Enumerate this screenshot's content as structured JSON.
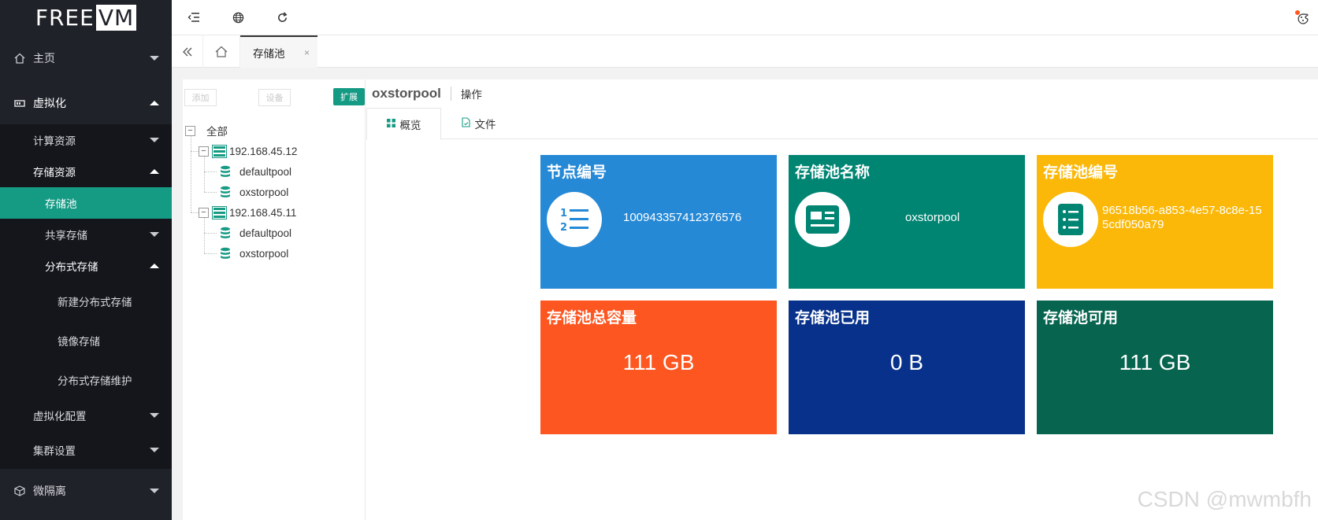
{
  "app": {
    "logo_left": "FREE",
    "logo_right": "VM"
  },
  "sidebar": {
    "home": "主页",
    "virtualization": "虚拟化",
    "compute": "计算资源",
    "storage": "存储资源",
    "storage_pool": "存储池",
    "shared_storage": "共享存储",
    "distributed_storage": "分布式存储",
    "new_distributed": "新建分布式存储",
    "image_storage": "镜像存储",
    "distributed_maint": "分布式存储维护",
    "virt_config": "虚拟化配置",
    "cluster_settings": "集群设置",
    "micro_isolation": "微隔离"
  },
  "tabbar": {
    "current_tab": "存储池",
    "close": "×"
  },
  "tree_panel": {
    "btn_add": "添加",
    "btn_device": "设备",
    "btn_extend": "扩展",
    "root": "全部",
    "hosts": [
      {
        "ip": "192.168.45.12",
        "pools": [
          "defaultpool",
          "oxstorpool"
        ]
      },
      {
        "ip": "192.168.45.11",
        "pools": [
          "defaultpool",
          "oxstorpool"
        ]
      }
    ]
  },
  "main": {
    "pool_title": "oxstorpool",
    "operation": "操作",
    "tab_overview": "概览",
    "tab_files": "文件"
  },
  "cards": {
    "node_id_title": "节点编号",
    "node_id_value": "100943357412376576",
    "pool_name_title": "存储池名称",
    "pool_name_value": "oxstorpool",
    "pool_id_title": "存储池编号",
    "pool_id_value": "96518b56-a853-4e57-8c8e-155cdf050a79",
    "total_title": "存储池总容量",
    "total_value": "111 GB",
    "used_title": "存储池已用",
    "used_value": "0 B",
    "avail_title": "存储池可用",
    "avail_value": "111 GB"
  },
  "colors": {
    "accent": "#159a84",
    "card_blue": "#2589d6",
    "card_teal": "#008573",
    "card_yellow": "#fbb808",
    "card_orange": "#fd5621",
    "card_navy": "#07318a",
    "card_green": "#06644f"
  },
  "watermark": "CSDN @mwmbfh"
}
